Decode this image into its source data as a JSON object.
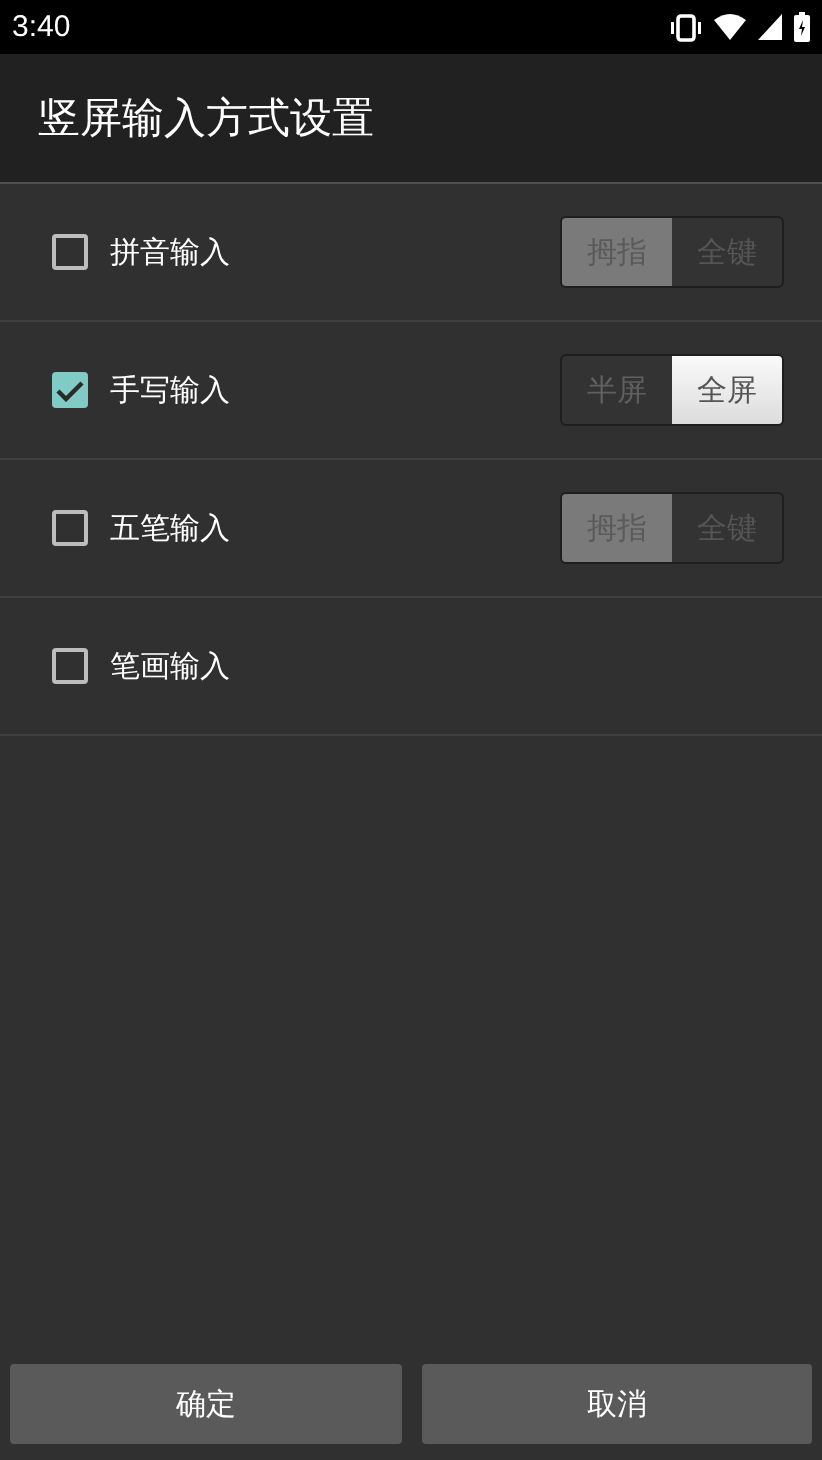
{
  "status_bar": {
    "time": "3:40"
  },
  "title": "竖屏输入方式设置",
  "options": [
    {
      "label": "拼音输入",
      "checked": false,
      "modes": [
        {
          "label": "拇指",
          "selected": true
        },
        {
          "label": "全键",
          "selected": false
        }
      ]
    },
    {
      "label": "手写输入",
      "checked": true,
      "modes": [
        {
          "label": "半屏",
          "selected": false
        },
        {
          "label": "全屏",
          "selected": true
        }
      ]
    },
    {
      "label": "五笔输入",
      "checked": false,
      "modes": [
        {
          "label": "拇指",
          "selected": true
        },
        {
          "label": "全键",
          "selected": false
        }
      ]
    },
    {
      "label": "笔画输入",
      "checked": false
    }
  ],
  "buttons": [
    "确定",
    "取消"
  ]
}
